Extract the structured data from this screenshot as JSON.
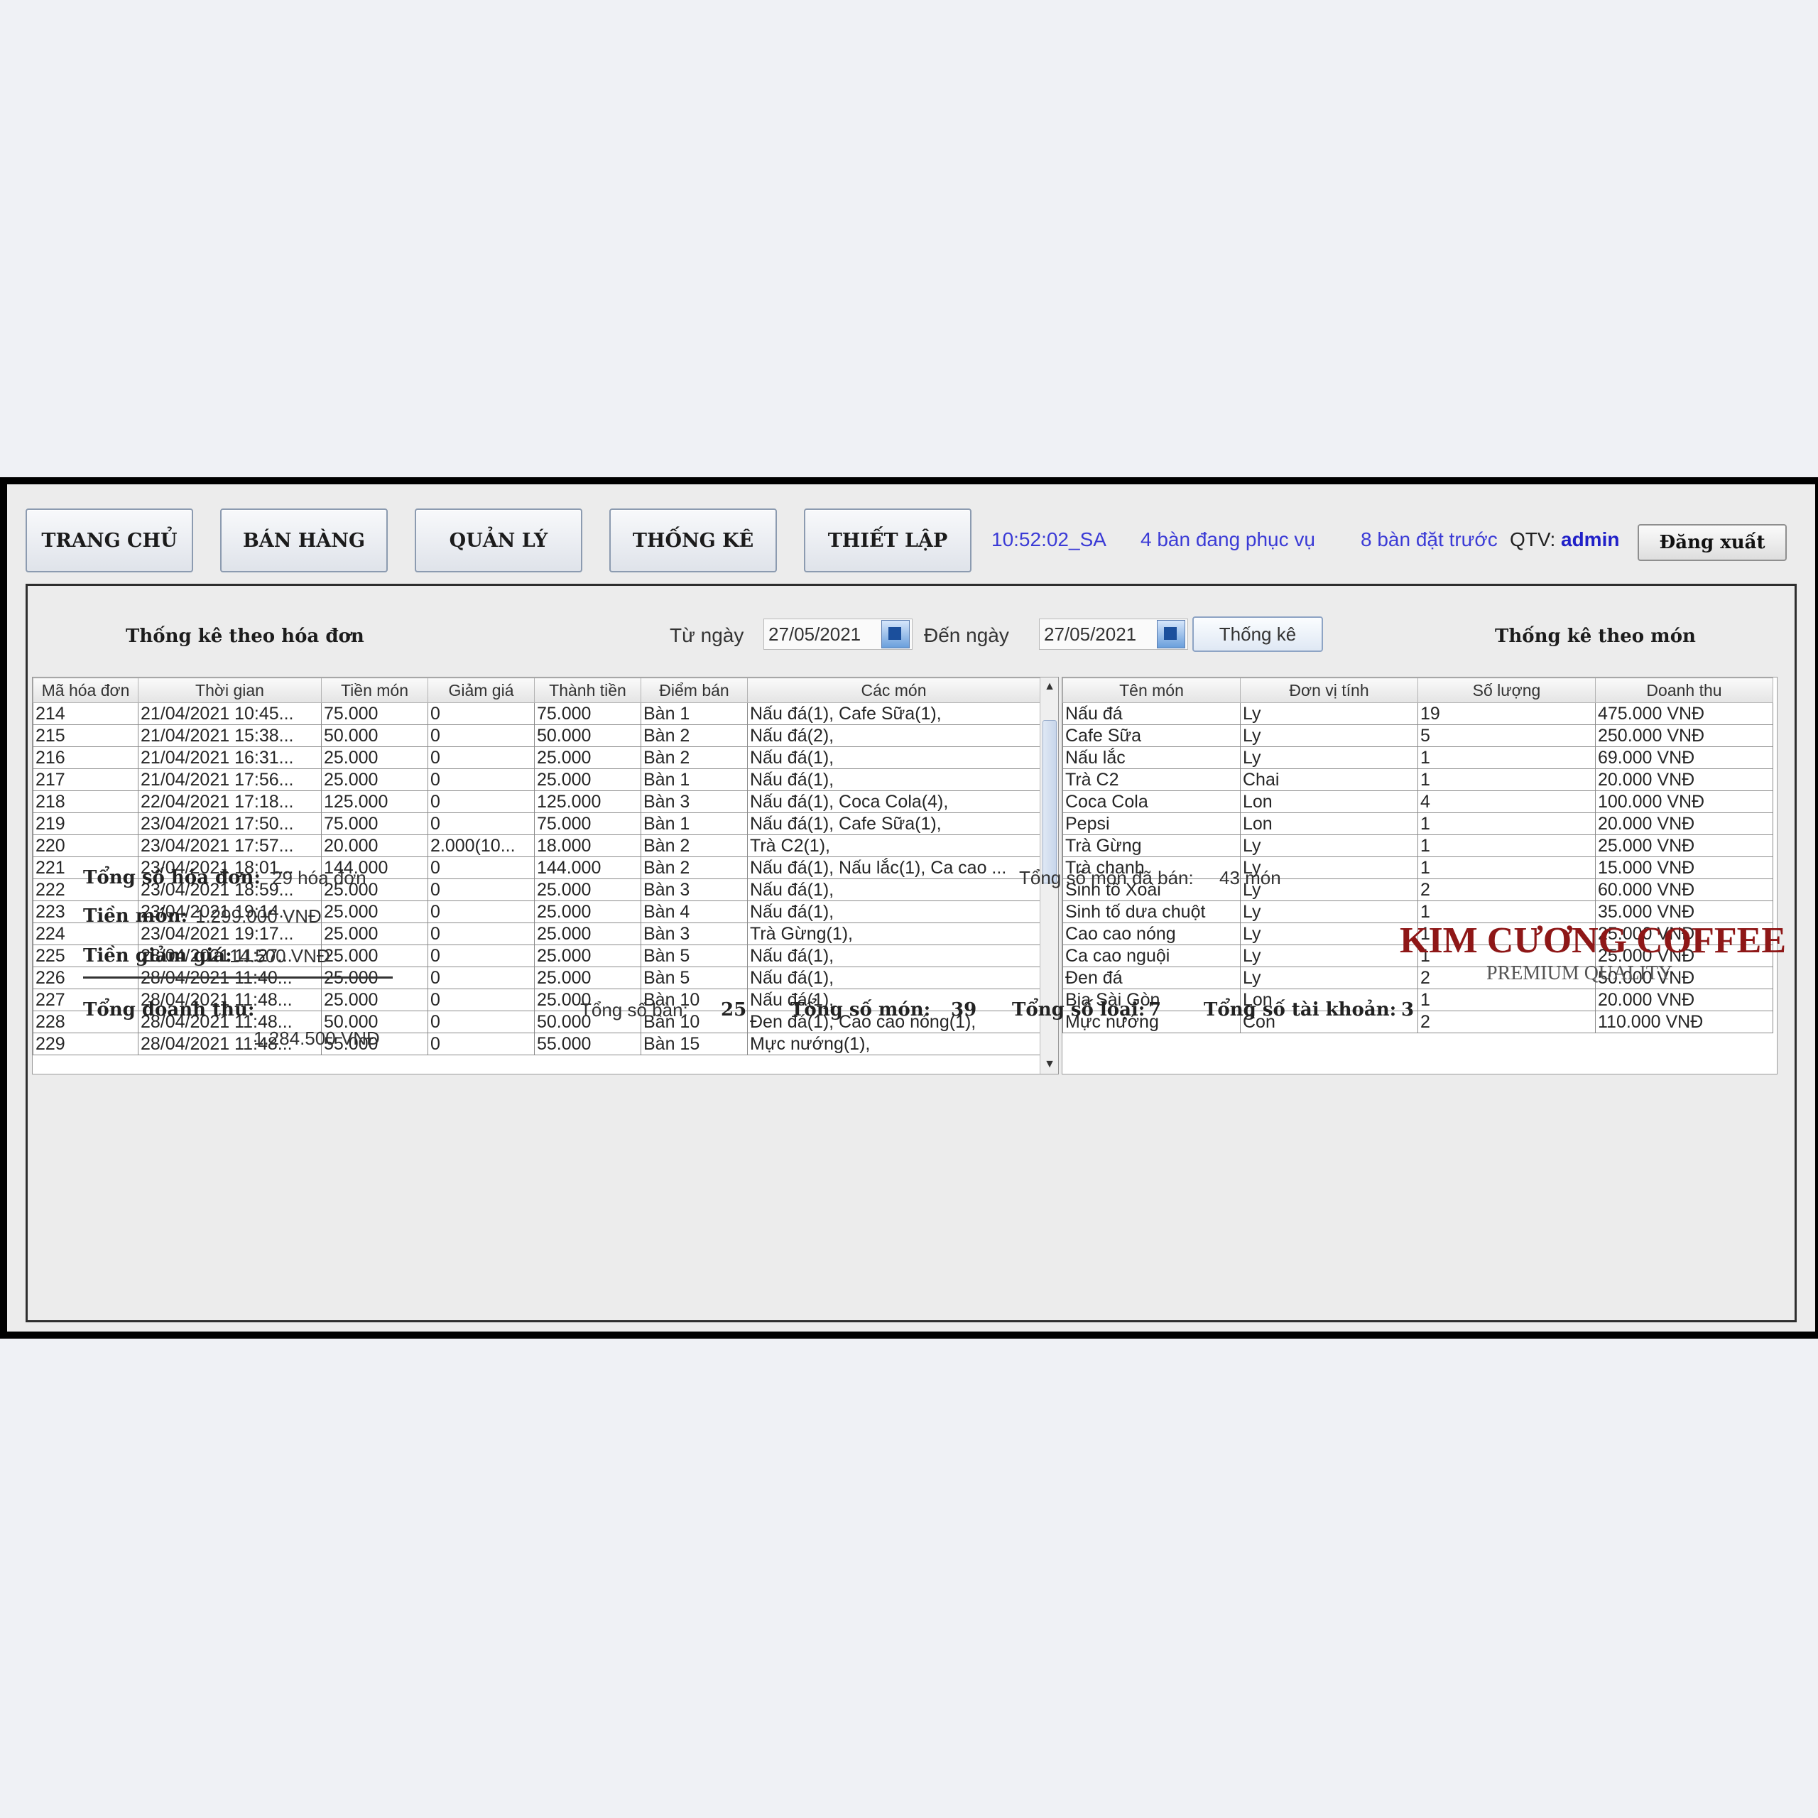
{
  "nav": {
    "home": "TRANG CHỦ",
    "sales": "BÁN HÀNG",
    "manage": "QUẢN LÝ",
    "stats": "THỐNG KÊ",
    "settings": "THIẾT LẬP"
  },
  "header": {
    "clock": "10:52:02_SA",
    "serving": "4 bàn đang phục vụ",
    "reserved": "8 bàn đặt trước",
    "admin_label": "QTV:",
    "admin_name": "admin",
    "logout": "Đăng xuất"
  },
  "filter": {
    "by_invoice_title": "Thống kê theo hóa đơn",
    "from_label": "Từ ngày",
    "from_value": "27/05/2021",
    "to_label": "Đến ngày",
    "to_value": "27/05/2021",
    "submit": "Thống kê",
    "by_item_title": "Thống kê theo món"
  },
  "invoices": {
    "columns": [
      "Mã hóa đơn",
      "Thời gian",
      "Tiền món",
      "Giảm giá",
      "Thành tiền",
      "Điểm bán",
      "Các món"
    ],
    "rows": [
      [
        "214",
        "21/04/2021 10:45...",
        "75.000",
        "0",
        "75.000",
        "Bàn 1",
        "Nấu đá(1), Cafe Sữa(1),"
      ],
      [
        "215",
        "21/04/2021 15:38...",
        "50.000",
        "0",
        "50.000",
        "Bàn 2",
        "Nấu đá(2),"
      ],
      [
        "216",
        "21/04/2021 16:31...",
        "25.000",
        "0",
        "25.000",
        "Bàn 2",
        "Nấu đá(1),"
      ],
      [
        "217",
        "21/04/2021 17:56...",
        "25.000",
        "0",
        "25.000",
        "Bàn 1",
        "Nấu đá(1),"
      ],
      [
        "218",
        "22/04/2021 17:18...",
        "125.000",
        "0",
        "125.000",
        "Bàn 3",
        "Nấu đá(1), Coca Cola(4),"
      ],
      [
        "219",
        "23/04/2021 17:50...",
        "75.000",
        "0",
        "75.000",
        "Bàn 1",
        "Nấu đá(1), Cafe Sữa(1),"
      ],
      [
        "220",
        "23/04/2021 17:57...",
        "20.000",
        "2.000(10...",
        "18.000",
        "Bàn 2",
        "Trà C2(1),"
      ],
      [
        "221",
        "23/04/2021 18:01...",
        "144.000",
        "0",
        "144.000",
        "Bàn 2",
        "Nấu đá(1), Nấu lắc(1), Ca cao ..."
      ],
      [
        "222",
        "23/04/2021 18:59...",
        "25.000",
        "0",
        "25.000",
        "Bàn 3",
        "Nấu đá(1),"
      ],
      [
        "223",
        "23/04/2021 19:14...",
        "25.000",
        "0",
        "25.000",
        "Bàn 4",
        "Nấu đá(1),"
      ],
      [
        "224",
        "23/04/2021 19:17...",
        "25.000",
        "0",
        "25.000",
        "Bàn 3",
        "Trà Gừng(1),"
      ],
      [
        "225",
        "28/04/2021 11:27...",
        "25.000",
        "0",
        "25.000",
        "Bàn 5",
        "Nấu đá(1),"
      ],
      [
        "226",
        "28/04/2021 11:40...",
        "25.000",
        "0",
        "25.000",
        "Bàn 5",
        "Nấu đá(1),"
      ],
      [
        "227",
        "28/04/2021 11:48...",
        "25.000",
        "0",
        "25.000",
        "Bàn 10",
        "Nấu đá(1),"
      ],
      [
        "228",
        "28/04/2021 11:48...",
        "50.000",
        "0",
        "50.000",
        "Bàn 10",
        "Đen đá(1), Cao cao nóng(1),"
      ],
      [
        "229",
        "28/04/2021 11:48...",
        "55.000",
        "0",
        "55.000",
        "Bàn 15",
        "Mực nướng(1),"
      ]
    ]
  },
  "items": {
    "columns": [
      "Tên món",
      "Đơn vị tính",
      "Số lượng",
      "Doanh thu"
    ],
    "rows": [
      [
        "Nấu đá",
        "Ly",
        "19",
        "475.000 VNĐ"
      ],
      [
        "Cafe Sữa",
        "Ly",
        "5",
        "250.000 VNĐ"
      ],
      [
        "Nấu lắc",
        "Ly",
        "1",
        "69.000 VNĐ"
      ],
      [
        "Trà C2",
        "Chai",
        "1",
        "20.000 VNĐ"
      ],
      [
        "Coca Cola",
        "Lon",
        "4",
        "100.000 VNĐ"
      ],
      [
        "Pepsi",
        "Lon",
        "1",
        "20.000 VNĐ"
      ],
      [
        "Trà Gừng",
        "Ly",
        "1",
        "25.000 VNĐ"
      ],
      [
        "Trà chanh",
        "Ly",
        "1",
        "15.000 VNĐ"
      ],
      [
        "Sinh tố Xoài",
        "Ly",
        "2",
        "60.000 VNĐ"
      ],
      [
        "Sinh tố dưa chuột",
        "Ly",
        "1",
        "35.000 VNĐ"
      ],
      [
        "Cao cao nóng",
        "Ly",
        "1",
        "25.000 VNĐ"
      ],
      [
        "Ca cao nguội",
        "Ly",
        "1",
        "25.000 VNĐ"
      ],
      [
        "Đen đá",
        "Ly",
        "2",
        "50.000 VNĐ"
      ],
      [
        "Bia Sài Gòn",
        "Lon",
        "1",
        "20.000 VNĐ"
      ],
      [
        "Mực nướng",
        "Con",
        "2",
        "110.000 VNĐ"
      ]
    ]
  },
  "summary": {
    "invoice_count_label": "Tổng số hóa đơn:",
    "invoice_count_value": "29 hóa đơn",
    "items_sold_label": "Tổng số món đã bán:",
    "items_sold_value": "43 món",
    "item_money_label": "Tiền món:",
    "item_money_value": "1.299.000 VNĐ",
    "discount_label": "Tiền giảm giá:",
    "discount_value": "14.500 VNĐ",
    "revenue_label": "Tổng doanh thu:",
    "revenue_value": "1.284.500 VNĐ",
    "tables_label": "Tổng số bàn:",
    "tables_value": "25",
    "dishes_label": "Tổng số món:",
    "dishes_value": "39",
    "types_label": "Tổng số loại:",
    "types_value": "7",
    "accounts_label": "Tổng số tài khoản:",
    "accounts_value": "3"
  },
  "brand": {
    "name": "KIM CƯƠNG COFFEE",
    "tagline": "PREMIUM QUALITY",
    "color": "#8e1717"
  }
}
